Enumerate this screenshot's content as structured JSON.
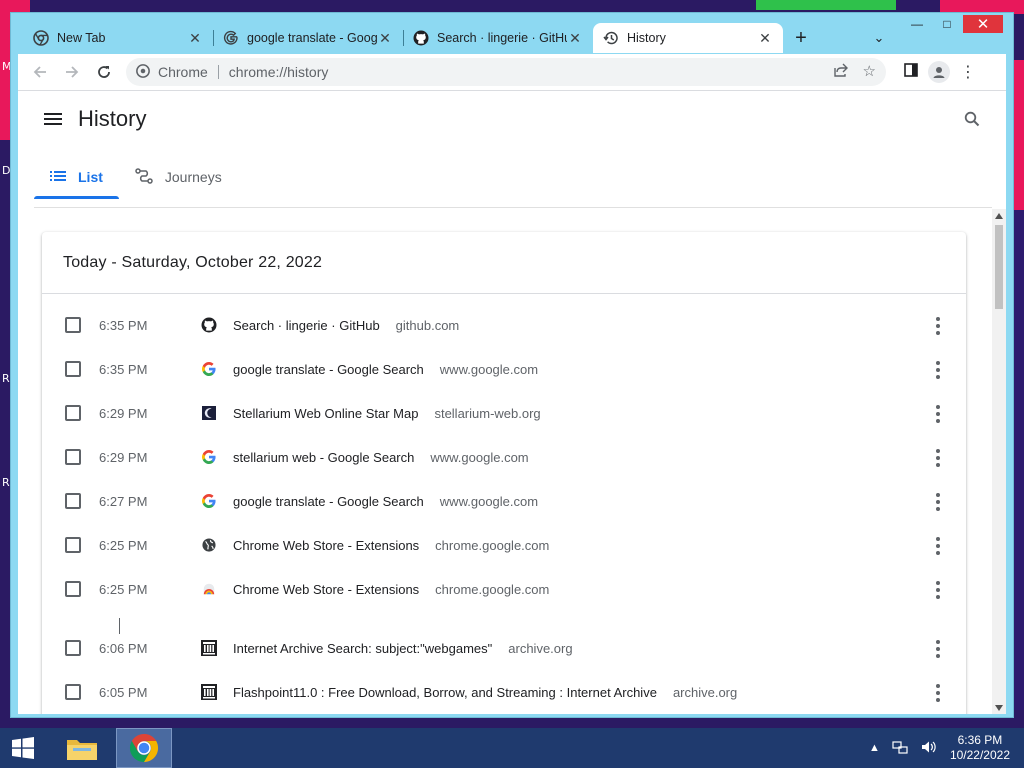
{
  "desktop": {
    "edge_letters": [
      "M",
      "D",
      "R",
      "R"
    ]
  },
  "browser": {
    "tabs": [
      {
        "title": "New Tab",
        "icon": "chrome-icon"
      },
      {
        "title": "google translate - Goog",
        "icon": "google-icon"
      },
      {
        "title": "Search · lingerie · GitHu",
        "icon": "github-icon"
      },
      {
        "title": "History",
        "icon": "history-icon",
        "active": true
      }
    ],
    "omnibox": {
      "scheme_label": "Chrome",
      "url": "chrome://history"
    }
  },
  "history": {
    "title": "History",
    "tabs": [
      {
        "label": "List",
        "icon": "list-icon",
        "active": true
      },
      {
        "label": "Journeys",
        "icon": "journeys-icon",
        "active": false
      }
    ],
    "day_header": "Today - Saturday, October 22, 2022",
    "entries": [
      {
        "time": "6:35 PM",
        "title": "Search · lingerie · GitHub",
        "domain": "github.com",
        "icon": "github-icon"
      },
      {
        "time": "6:35 PM",
        "title": "google translate - Google Search",
        "domain": "www.google.com",
        "icon": "google-icon"
      },
      {
        "time": "6:29 PM",
        "title": "Stellarium Web Online Star Map",
        "domain": "stellarium-web.org",
        "icon": "stellarium-icon"
      },
      {
        "time": "6:29 PM",
        "title": "stellarium web - Google Search",
        "domain": "www.google.com",
        "icon": "google-icon"
      },
      {
        "time": "6:27 PM",
        "title": "google translate - Google Search",
        "domain": "www.google.com",
        "icon": "google-icon"
      },
      {
        "time": "6:25 PM",
        "title": "Chrome Web Store - Extensions",
        "domain": "chrome.google.com",
        "icon": "globe-icon"
      },
      {
        "time": "6:25 PM",
        "title": "Chrome Web Store - Extensions",
        "domain": "chrome.google.com",
        "icon": "webstore-icon"
      },
      {
        "time": "6:06 PM",
        "title": "Internet Archive Search: subject:\"webgames\"",
        "domain": "archive.org",
        "icon": "archive-icon"
      },
      {
        "time": "6:05 PM",
        "title": "Flashpoint11.0 : Free Download, Borrow, and Streaming : Internet Archive",
        "domain": "archive.org",
        "icon": "archive-icon"
      }
    ]
  },
  "taskbar": {
    "time": "6:36 PM",
    "date": "10/22/2022"
  },
  "colors": {
    "accent": "#1a73e8",
    "tab_strip": "#8dd9f2",
    "taskbar": "#1f3a6e"
  }
}
